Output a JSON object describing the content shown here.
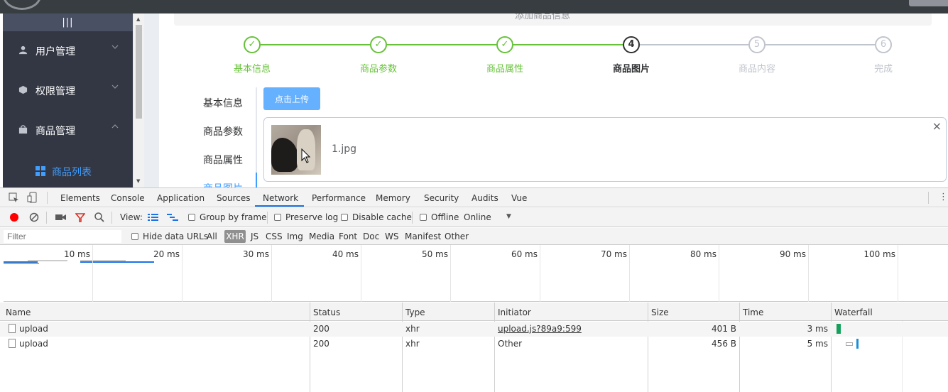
{
  "sidebar": {
    "toggle_label": "|||",
    "items": [
      {
        "label": "用户管理",
        "arrow": "⌄"
      },
      {
        "label": "权限管理",
        "arrow": "⌄"
      },
      {
        "label": "商品管理",
        "arrow": "⌃"
      }
    ],
    "sub_item": "商品列表"
  },
  "alert": {
    "text": "添加商品信息"
  },
  "steps": [
    {
      "num": "✓",
      "title": "基本信息",
      "state": "done"
    },
    {
      "num": "✓",
      "title": "商品参数",
      "state": "done"
    },
    {
      "num": "✓",
      "title": "商品属性",
      "state": "done"
    },
    {
      "num": "4",
      "title": "商品图片",
      "state": "active"
    },
    {
      "num": "5",
      "title": "商品内容",
      "state": "wait"
    },
    {
      "num": "6",
      "title": "完成",
      "state": "wait"
    }
  ],
  "vtabs": [
    "基本信息",
    "商品参数",
    "商品属性",
    "商品图片"
  ],
  "upload": {
    "button_label": "点击上传",
    "file_name": "1.jpg",
    "close": "×"
  },
  "devtools": {
    "tabs": [
      "Elements",
      "Console",
      "Application",
      "Sources",
      "Network",
      "Performance",
      "Memory",
      "Security",
      "Audits",
      "Vue"
    ],
    "selected_tab": "Network",
    "toolbar": {
      "view_label": "View:",
      "group_by_frame": "Group by frame",
      "preserve_log": "Preserve log",
      "disable_cache": "Disable cache",
      "offline": "Offline",
      "throttle": "Online"
    },
    "filter": {
      "placeholder": "Filter",
      "hide_data_urls": "Hide data URLs",
      "types": [
        "All",
        "XHR",
        "JS",
        "CSS",
        "Img",
        "Media",
        "Font",
        "Doc",
        "WS",
        "Manifest",
        "Other"
      ],
      "selected_type": "XHR"
    },
    "overview_ticks": [
      "10 ms",
      "20 ms",
      "30 ms",
      "40 ms",
      "50 ms",
      "60 ms",
      "70 ms",
      "80 ms",
      "90 ms",
      "100 ms"
    ],
    "columns": [
      "Name",
      "Status",
      "Type",
      "Initiator",
      "Size",
      "Time",
      "Waterfall"
    ],
    "rows": [
      {
        "name": "upload",
        "status": "200",
        "type": "xhr",
        "initiator": "upload.js?89a9:599",
        "size": "401 B",
        "time": "3 ms"
      },
      {
        "name": "upload",
        "status": "200",
        "type": "xhr",
        "initiator": "Other",
        "size": "456 B",
        "time": "5 ms"
      }
    ]
  },
  "colors": {
    "accent": "#409eff",
    "success": "#67c23a",
    "sidebar": "#333744",
    "record": "#ff0000",
    "filter_icon": "#d93025"
  }
}
